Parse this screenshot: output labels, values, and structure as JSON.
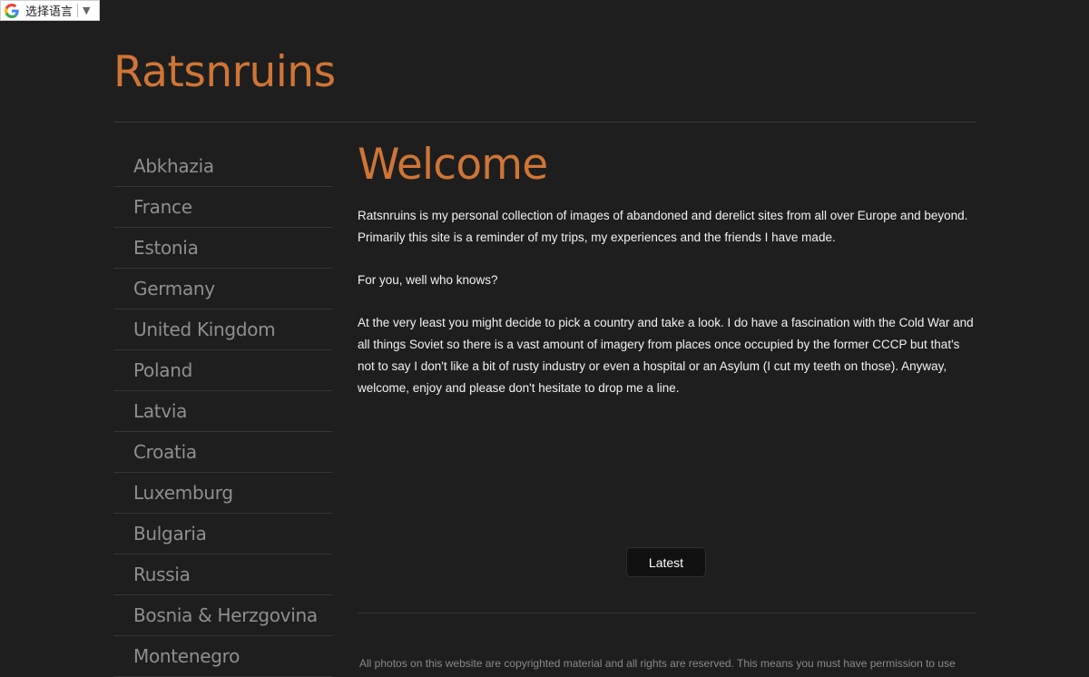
{
  "translate_widget": {
    "label": "选择语言",
    "arrow": "▼",
    "icon": "google-g-icon"
  },
  "site": {
    "title": "Ratsnruins"
  },
  "sidebar": {
    "items": [
      {
        "label": "Abkhazia"
      },
      {
        "label": "France"
      },
      {
        "label": "Estonia"
      },
      {
        "label": "Germany"
      },
      {
        "label": "United Kingdom"
      },
      {
        "label": "Poland"
      },
      {
        "label": "Latvia"
      },
      {
        "label": "Croatia"
      },
      {
        "label": "Luxemburg"
      },
      {
        "label": "Bulgaria"
      },
      {
        "label": "Russia"
      },
      {
        "label": "Bosnia & Herzgovina"
      },
      {
        "label": "Montenegro"
      }
    ]
  },
  "main": {
    "heading": "Welcome",
    "paragraphs": [
      "Ratsnruins is my personal collection of images of abandoned and derelict sites from all over Europe and beyond. Primarily this site is a reminder of my trips, my experiences and the friends I have made.",
      "For you, well who knows?",
      "At the very least you might decide to pick a country and take a look. I do have a fascination with the Cold War and all things Soviet so there is a vast amount of imagery from places once occupied by the former CCCP but that's not to say I don't like a bit of rusty industry or even a hospital or an Asylum (I cut my teeth on those). Anyway, welcome, enjoy and please don't hesitate to drop me a line."
    ],
    "latest_button": "Latest"
  },
  "footer": {
    "copyright": "All photos on this website are copyrighted material and all rights are reserved. This means you must have permission to use"
  },
  "colors": {
    "background": "#1e1e1e",
    "accent": "#cf7536",
    "nav_text": "#8f8f8f",
    "body_text": "#f2f2f2"
  }
}
